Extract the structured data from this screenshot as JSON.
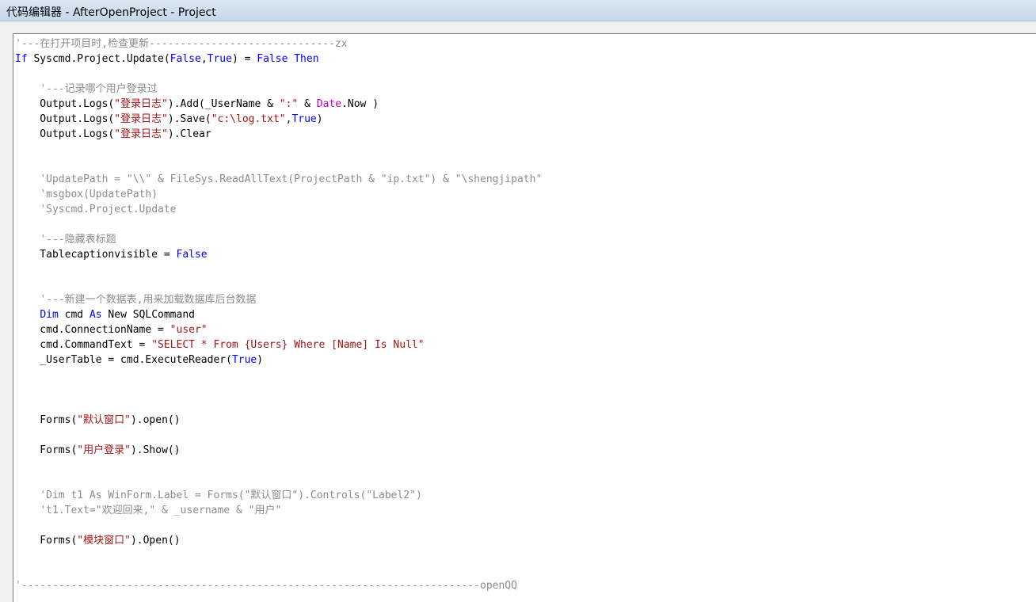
{
  "window": {
    "title": "代码编辑器 - AfterOpenProject - Project"
  },
  "colors": {
    "plain": "#000000",
    "keyword": "#0000ff",
    "string": "#a31515",
    "comment": "#8c8c8c",
    "builtin": "#c000c0"
  },
  "code_lines": [
    [
      {
        "t": "'---在打开项目时,检查更新------------------------------zx",
        "k": "comment"
      }
    ],
    [
      {
        "t": "If",
        "k": "keyword"
      },
      {
        "t": " Syscmd.Project.Update(",
        "k": "plain"
      },
      {
        "t": "False",
        "k": "keyword"
      },
      {
        "t": ",",
        "k": "plain"
      },
      {
        "t": "True",
        "k": "keyword"
      },
      {
        "t": ") = ",
        "k": "plain"
      },
      {
        "t": "False",
        "k": "keyword"
      },
      {
        "t": " ",
        "k": "plain"
      },
      {
        "t": "Then",
        "k": "keyword"
      }
    ],
    [],
    [
      {
        "t": "    ",
        "k": "plain"
      },
      {
        "t": "'---记录哪个用户登录过",
        "k": "comment"
      }
    ],
    [
      {
        "t": "    Output.Logs(",
        "k": "plain"
      },
      {
        "t": "\"登录日志\"",
        "k": "string"
      },
      {
        "t": ").Add(_UserName & ",
        "k": "plain"
      },
      {
        "t": "\":\"",
        "k": "string"
      },
      {
        "t": " & ",
        "k": "plain"
      },
      {
        "t": "Date",
        "k": "builtin"
      },
      {
        "t": ".Now )",
        "k": "plain"
      }
    ],
    [
      {
        "t": "    Output.Logs(",
        "k": "plain"
      },
      {
        "t": "\"登录日志\"",
        "k": "string"
      },
      {
        "t": ").Save(",
        "k": "plain"
      },
      {
        "t": "\"c:\\log.txt\"",
        "k": "string"
      },
      {
        "t": ",",
        "k": "plain"
      },
      {
        "t": "True",
        "k": "keyword"
      },
      {
        "t": ")",
        "k": "plain"
      }
    ],
    [
      {
        "t": "    Output.Logs(",
        "k": "plain"
      },
      {
        "t": "\"登录日志\"",
        "k": "string"
      },
      {
        "t": ").Clear",
        "k": "plain"
      }
    ],
    [],
    [],
    [
      {
        "t": "    ",
        "k": "plain"
      },
      {
        "t": "'UpdatePath = \"\\\\\" & FileSys.ReadAllText(ProjectPath & \"ip.txt\") & \"\\shengjipath\"",
        "k": "comment"
      }
    ],
    [
      {
        "t": "    ",
        "k": "plain"
      },
      {
        "t": "'msgbox(UpdatePath)",
        "k": "comment"
      }
    ],
    [
      {
        "t": "    ",
        "k": "plain"
      },
      {
        "t": "'Syscmd.Project.Update",
        "k": "comment"
      }
    ],
    [],
    [
      {
        "t": "    ",
        "k": "plain"
      },
      {
        "t": "'---隐藏表标题",
        "k": "comment"
      }
    ],
    [
      {
        "t": "    Tablecaptionvisible = ",
        "k": "plain"
      },
      {
        "t": "False",
        "k": "keyword"
      }
    ],
    [],
    [],
    [
      {
        "t": "    ",
        "k": "plain"
      },
      {
        "t": "'---新建一个数据表,用来加载数据库后台数据",
        "k": "comment"
      }
    ],
    [
      {
        "t": "    ",
        "k": "plain"
      },
      {
        "t": "Dim",
        "k": "keyword"
      },
      {
        "t": " cmd ",
        "k": "plain"
      },
      {
        "t": "As",
        "k": "keyword"
      },
      {
        "t": " New SQLCommand",
        "k": "plain"
      }
    ],
    [
      {
        "t": "    cmd.ConnectionName = ",
        "k": "plain"
      },
      {
        "t": "\"user\"",
        "k": "string"
      }
    ],
    [
      {
        "t": "    cmd.CommandText = ",
        "k": "plain"
      },
      {
        "t": "\"SELECT * From {Users} Where [Name] Is Null\"",
        "k": "string"
      }
    ],
    [
      {
        "t": "    _UserTable = cmd.ExecuteReader(",
        "k": "plain"
      },
      {
        "t": "True",
        "k": "keyword"
      },
      {
        "t": ")",
        "k": "plain"
      }
    ],
    [],
    [],
    [],
    [
      {
        "t": "    Forms(",
        "k": "plain"
      },
      {
        "t": "\"默认窗口\"",
        "k": "string"
      },
      {
        "t": ").open()",
        "k": "plain"
      }
    ],
    [],
    [
      {
        "t": "    Forms(",
        "k": "plain"
      },
      {
        "t": "\"用户登录\"",
        "k": "string"
      },
      {
        "t": ").Show()",
        "k": "plain"
      }
    ],
    [],
    [],
    [
      {
        "t": "    ",
        "k": "plain"
      },
      {
        "t": "'Dim t1 As WinForm.Label = Forms(\"默认窗口\").Controls(\"Label2\")",
        "k": "comment"
      }
    ],
    [
      {
        "t": "    ",
        "k": "plain"
      },
      {
        "t": "'t1.Text=\"欢迎回来,\" & _username & \"用户\"",
        "k": "comment"
      }
    ],
    [],
    [
      {
        "t": "    Forms(",
        "k": "plain"
      },
      {
        "t": "\"模块窗口\"",
        "k": "string"
      },
      {
        "t": ").Open()",
        "k": "plain"
      }
    ],
    [],
    [],
    [
      {
        "t": "'--------------------------------------------------------------------------openQQ",
        "k": "comment"
      }
    ]
  ]
}
